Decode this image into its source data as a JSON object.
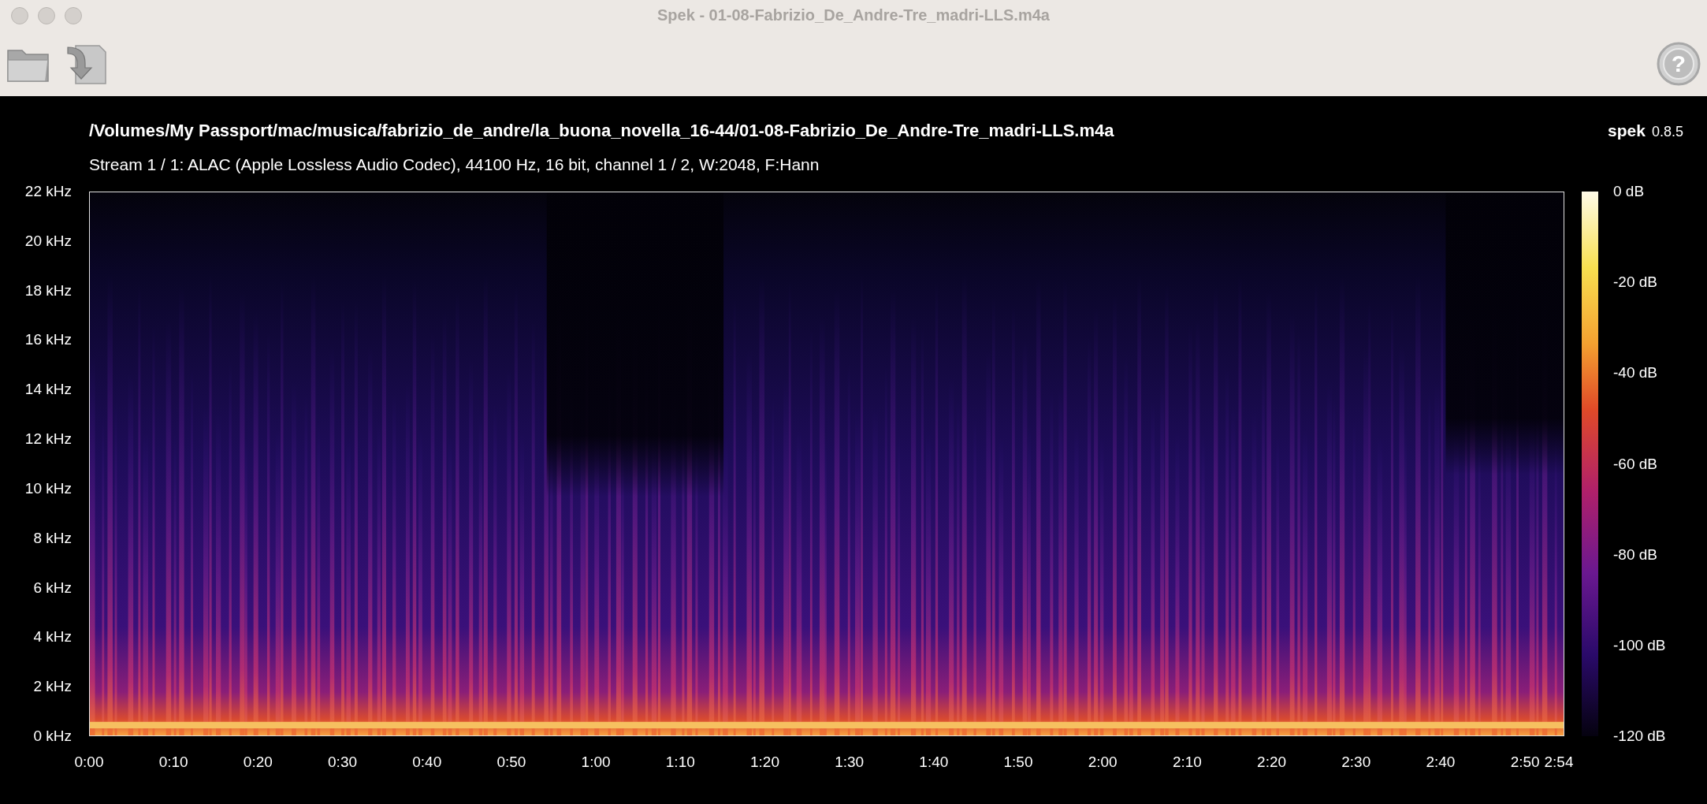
{
  "window": {
    "title": "Spek - 01-08-Fabrizio_De_Andre-Tre_madri-LLS.m4a"
  },
  "toolbar": {
    "help_glyph": "?"
  },
  "header": {
    "file_path": "/Volumes/My Passport/mac/musica/fabrizio_de_andre/la_buona_novella_16-44/01-08-Fabrizio_De_Andre-Tre_madri-LLS.m4a",
    "app_name": "spek",
    "version": "0.8.5",
    "stream_info": "Stream 1 / 1: ALAC (Apple Lossless Audio Codec), 44100 Hz, 16 bit, channel 1 / 2, W:2048, F:Hann"
  },
  "frequency_axis": [
    "22 kHz",
    "20 kHz",
    "18 kHz",
    "16 kHz",
    "14 kHz",
    "12 kHz",
    "10 kHz",
    "8 kHz",
    "6 kHz",
    "4 kHz",
    "2 kHz",
    "0 kHz"
  ],
  "time_axis": [
    "0:00",
    "0:10",
    "0:20",
    "0:30",
    "0:40",
    "0:50",
    "1:00",
    "1:10",
    "1:20",
    "1:30",
    "1:40",
    "1:50",
    "2:00",
    "2:10",
    "2:20",
    "2:30",
    "2:40",
    "2:50",
    "2:54"
  ],
  "level_scale": [
    "0 dB",
    "-20 dB",
    "-40 dB",
    "-60 dB",
    "-80 dB",
    "-100 dB",
    "-120 dB"
  ]
}
